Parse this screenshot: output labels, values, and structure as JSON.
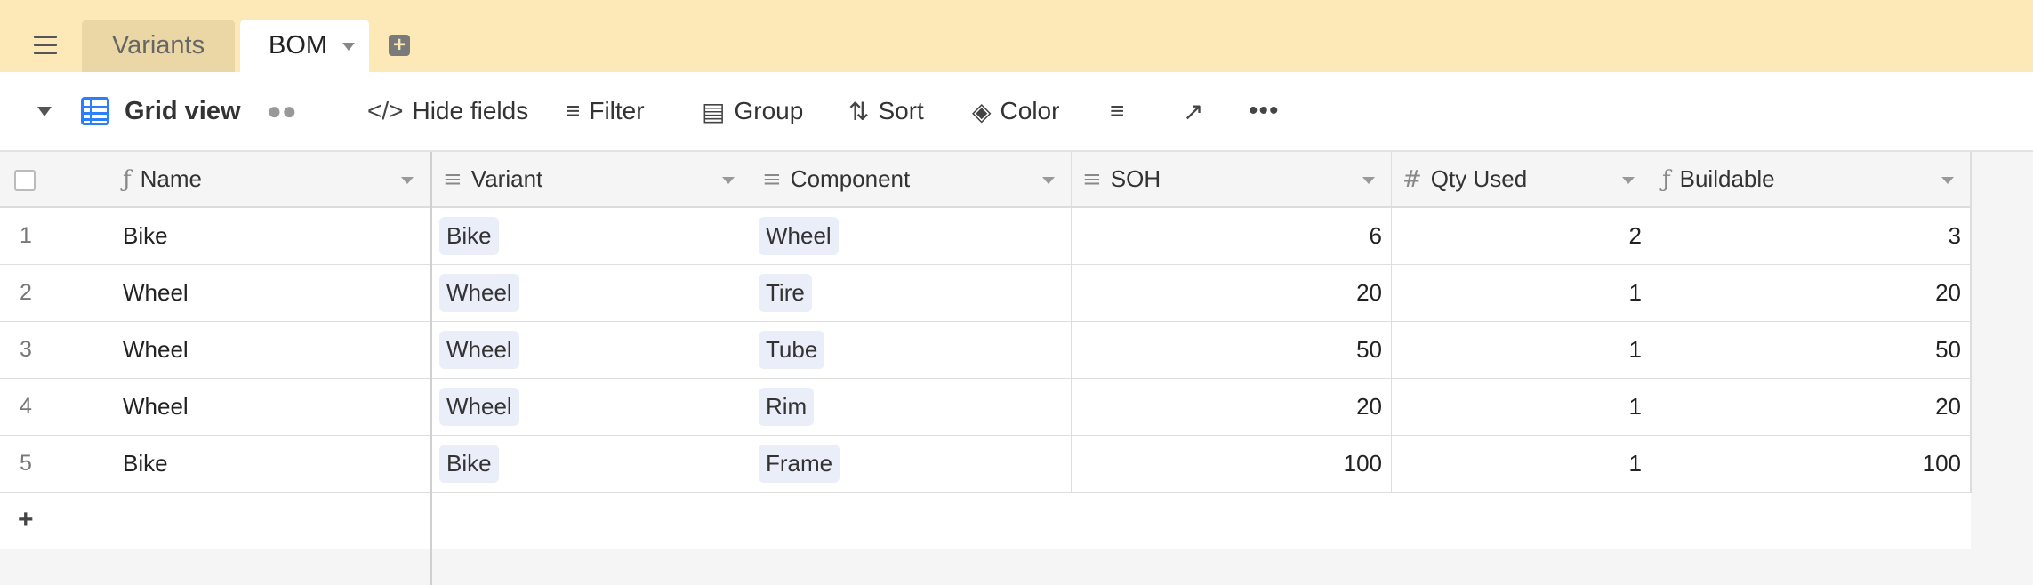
{
  "tabs": {
    "variants": "Variants",
    "bom": "BOM"
  },
  "toolbar": {
    "view_name": "Grid view",
    "hide_fields": "Hide fields",
    "filter": "Filter",
    "group": "Group",
    "sort": "Sort",
    "color": "Color"
  },
  "columns": [
    {
      "label": "Name",
      "icon": "formula-icon"
    },
    {
      "label": "Variant",
      "icon": "linked-record-icon"
    },
    {
      "label": "Component",
      "icon": "linked-record-icon"
    },
    {
      "label": "SOH",
      "icon": "lookup-icon"
    },
    {
      "label": "Qty Used",
      "icon": "number-icon"
    },
    {
      "label": "Buildable",
      "icon": "formula-icon"
    }
  ],
  "rows": [
    {
      "num": "1",
      "name": "Bike",
      "variant": "Bike",
      "component": "Wheel",
      "soh": "6",
      "qty": "2",
      "buildable": "3"
    },
    {
      "num": "2",
      "name": "Wheel",
      "variant": "Wheel",
      "component": "Tire",
      "soh": "20",
      "qty": "1",
      "buildable": "20"
    },
    {
      "num": "3",
      "name": "Wheel",
      "variant": "Wheel",
      "component": "Tube",
      "soh": "50",
      "qty": "1",
      "buildable": "50"
    },
    {
      "num": "4",
      "name": "Wheel",
      "variant": "Wheel",
      "component": "Rim",
      "soh": "20",
      "qty": "1",
      "buildable": "20"
    },
    {
      "num": "5",
      "name": "Bike",
      "variant": "Bike",
      "component": "Frame",
      "soh": "100",
      "qty": "1",
      "buildable": "100"
    }
  ],
  "colors": {
    "tabbar_bg": "#fde8b8",
    "accent_blue": "#2d7ff9",
    "pill_bg": "#e9eef9"
  }
}
